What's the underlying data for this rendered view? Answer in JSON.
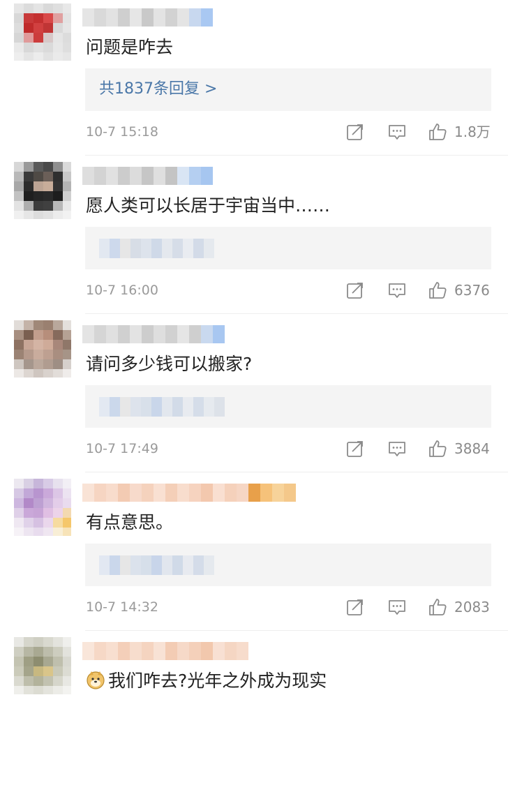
{
  "comments": [
    {
      "avatar": [
        "#e6e6e6",
        "#dcdcdc",
        "#e4e4e4",
        "#d9d9d9",
        "#dfdfdf",
        "#e8e8e8",
        "#d8d8d8",
        "#c83a3a",
        "#c43030",
        "#d94848",
        "#e0a0a0",
        "#e3e3e3",
        "#dddddd",
        "#bf2b2b",
        "#d14040",
        "#c03535",
        "#d9d9d9",
        "#e6e6e6",
        "#d6d6d6",
        "#e09a9a",
        "#cc3c3c",
        "#d7c8c8",
        "#e5e5e5",
        "#dcdcdc",
        "#e9e9e9",
        "#d8d8d8",
        "#e0e0e0",
        "#dadada",
        "#e7e7e7",
        "#dedede",
        "#eeeeee",
        "#e4e4e4",
        "#ececec",
        "#e2e2e2",
        "#eaeaea",
        "#e6e6e6"
      ],
      "name_blur": [
        "#e5e5e5",
        "#d9d9d9",
        "#e2e2e2",
        "#cfcfcf",
        "#e6e6e6",
        "#c9c9c9",
        "#e3e3e3",
        "#d2d2d2",
        "#e4e4e4",
        "#c8d8ef",
        "#a9c8f2"
      ],
      "text": "问题是咋去",
      "has_emoji": false,
      "reply_link": "共1837条回复 >",
      "reply_blur": [],
      "time": "10-7 15:18",
      "likes": "1.8万"
    },
    {
      "avatar": [
        "#d7d7d7",
        "#9a9a9a",
        "#5a5a5a",
        "#4a4a4a",
        "#8f8f8f",
        "#dadada",
        "#b9b9b9",
        "#3a3a3a",
        "#4f4a45",
        "#6b5f58",
        "#2f2f2f",
        "#c8c8c8",
        "#a8a8a8",
        "#2c2c2c",
        "#bca494",
        "#c8ad9a",
        "#333333",
        "#b4b4b4",
        "#c2c2c2",
        "#1f1f1f",
        "#262626",
        "#2a2a2a",
        "#1d1d1d",
        "#cfcfcf",
        "#e3e3e3",
        "#aeaeae",
        "#3c3c3c",
        "#404040",
        "#b8b8b8",
        "#e8e8e8",
        "#f0f0f0",
        "#e6e6e6",
        "#dcdcdc",
        "#e1e1e1",
        "#ececec",
        "#f2f2f2"
      ],
      "name_blur": [
        "#dedede",
        "#d3d3d3",
        "#e1e1e1",
        "#cccccc",
        "#dcdcdc",
        "#c6c6c6",
        "#dfdfdf",
        "#c4c4c4",
        "#d9e5f4",
        "#b5cff1",
        "#a6c6f0"
      ],
      "text": "愿人类可以长居于宇宙当中……",
      "has_emoji": false,
      "reply_link": "",
      "reply_blur": [
        "#e2e8f1",
        "#cdd9ec",
        "#e6e6e6",
        "#d7dde6",
        "#dde3ec",
        "#cfd9e8",
        "#e4e8ee",
        "#d6dde8",
        "#e9ecf1",
        "#d3dbe8",
        "#e5e9ee"
      ],
      "time": "10-7 16:00",
      "likes": "6376"
    },
    {
      "avatar": [
        "#e1dcd8",
        "#c4b3a8",
        "#a08878",
        "#9a8070",
        "#b9a89c",
        "#e4e0dc",
        "#a78f80",
        "#7a5f50",
        "#c29e8d",
        "#b78e7b",
        "#866a5c",
        "#b5a194",
        "#8e7262",
        "#c8a696",
        "#d4b4a4",
        "#cfab99",
        "#a8877a",
        "#8f7769",
        "#9b8374",
        "#b59a8c",
        "#c9ac9d",
        "#bea091",
        "#a98e80",
        "#a69487",
        "#cec6c0",
        "#a5968c",
        "#bba89c",
        "#b09c90",
        "#9e8e84",
        "#d6d0cc",
        "#ece8e5",
        "#ddd6d1",
        "#cfc6c0",
        "#d9d2cd",
        "#e2ddd9",
        "#efecea"
      ],
      "name_blur": [
        "#e4e4e4",
        "#d5d5d5",
        "#e0e0e0",
        "#d0d0d0",
        "#e3e3e3",
        "#cdcdcd",
        "#dedede",
        "#d1d1d1",
        "#e5e5e5",
        "#cfcfcf",
        "#c9d9ef",
        "#a8c7f1"
      ],
      "text": "请问多少钱可以搬家?",
      "has_emoji": false,
      "reply_link": "",
      "reply_blur": [
        "#e3e9f2",
        "#cbd8eb",
        "#e7e7e7",
        "#dde3ec",
        "#d8e0ea",
        "#c9d6ea",
        "#e2e7ee",
        "#d2dbe8",
        "#e8ebf0",
        "#d5dde9",
        "#e6eaef",
        "#dde2e9"
      ],
      "time": "10-7 17:49",
      "likes": "3884"
    },
    {
      "avatar": [
        "#ece8f0",
        "#d9d0e4",
        "#c7b6da",
        "#d8cbe6",
        "#e7e1ee",
        "#f2eff5",
        "#d6c8e4",
        "#c2a8d8",
        "#b895cf",
        "#caa9da",
        "#dcc6e6",
        "#ece3f1",
        "#cdb7df",
        "#b289c8",
        "#bda0d2",
        "#d0b6de",
        "#e3cde9",
        "#e9dbee",
        "#dfd0e8",
        "#caa8d9",
        "#c7a4d6",
        "#e0bfe3",
        "#ecd3e9",
        "#f3d9b0",
        "#efe8f2",
        "#e0d2e9",
        "#d6c1e2",
        "#ead7ec",
        "#f6dba0",
        "#f5c76b",
        "#f6f2f7",
        "#ede5f1",
        "#e8dcee",
        "#efe6f1",
        "#f8eed6",
        "#f7e3b8"
      ],
      "name_blur": [
        "#f9e3d6",
        "#f6d5c2",
        "#f8dccc",
        "#f3cbb3",
        "#f7dacb",
        "#f5d2bd",
        "#f9e0d2",
        "#f4cfb8",
        "#f8ddcd",
        "#f6d3bf",
        "#f3c8ae",
        "#f9dfd1",
        "#f5d1bb",
        "#f6d6c4",
        "#e8a04a",
        "#f6c27a",
        "#f7d39a",
        "#f4c88a"
      ],
      "text": "有点意思。",
      "has_emoji": false,
      "reply_link": "",
      "reply_blur": [
        "#e2e8f2",
        "#cad7eb",
        "#e6e6e6",
        "#dbe2ec",
        "#d6dfea",
        "#c8d5ea",
        "#e1e6ee",
        "#d0dae8",
        "#e7eaf0",
        "#d4dce9",
        "#e5e9ee"
      ],
      "time": "10-7 14:32",
      "likes": "2083"
    },
    {
      "avatar": [
        "#e8e8e4",
        "#d6d6cc",
        "#cfcfc3",
        "#d9d9cf",
        "#e3e3dd",
        "#efefec",
        "#cfcfc2",
        "#b7b7a4",
        "#a9a992",
        "#bdbdab",
        "#cdcdbf",
        "#e2e2dc",
        "#c4c4b2",
        "#9f9f84",
        "#8d8d70",
        "#a8a891",
        "#bfbfad",
        "#d8d8d0",
        "#cbcbba",
        "#a5a58b",
        "#c7b880",
        "#d9c58a",
        "#c9c9b8",
        "#dcdcd3",
        "#dadad0",
        "#bebeab",
        "#b3b39b",
        "#c2c2b0",
        "#d6d6cb",
        "#e8e8e3",
        "#efefeb",
        "#e2e2da",
        "#dcdcd2",
        "#e4e4dd",
        "#ececE7",
        "#f3f3f0"
      ],
      "name_blur": [
        "#f9e6da",
        "#f6d8c6",
        "#f8dfd0",
        "#f4cfb9",
        "#f7ddcd",
        "#f5d4c0",
        "#f8e2d5",
        "#f3ccb4",
        "#f6d9c8",
        "#f4d0ba",
        "#f2c8ad",
        "#f8e0d3",
        "#f5d6c3",
        "#f7dccc"
      ],
      "text": "我们咋去?光年之外成为现实",
      "has_emoji": true,
      "reply_link": "",
      "reply_blur": [],
      "time": "",
      "likes": ""
    }
  ]
}
